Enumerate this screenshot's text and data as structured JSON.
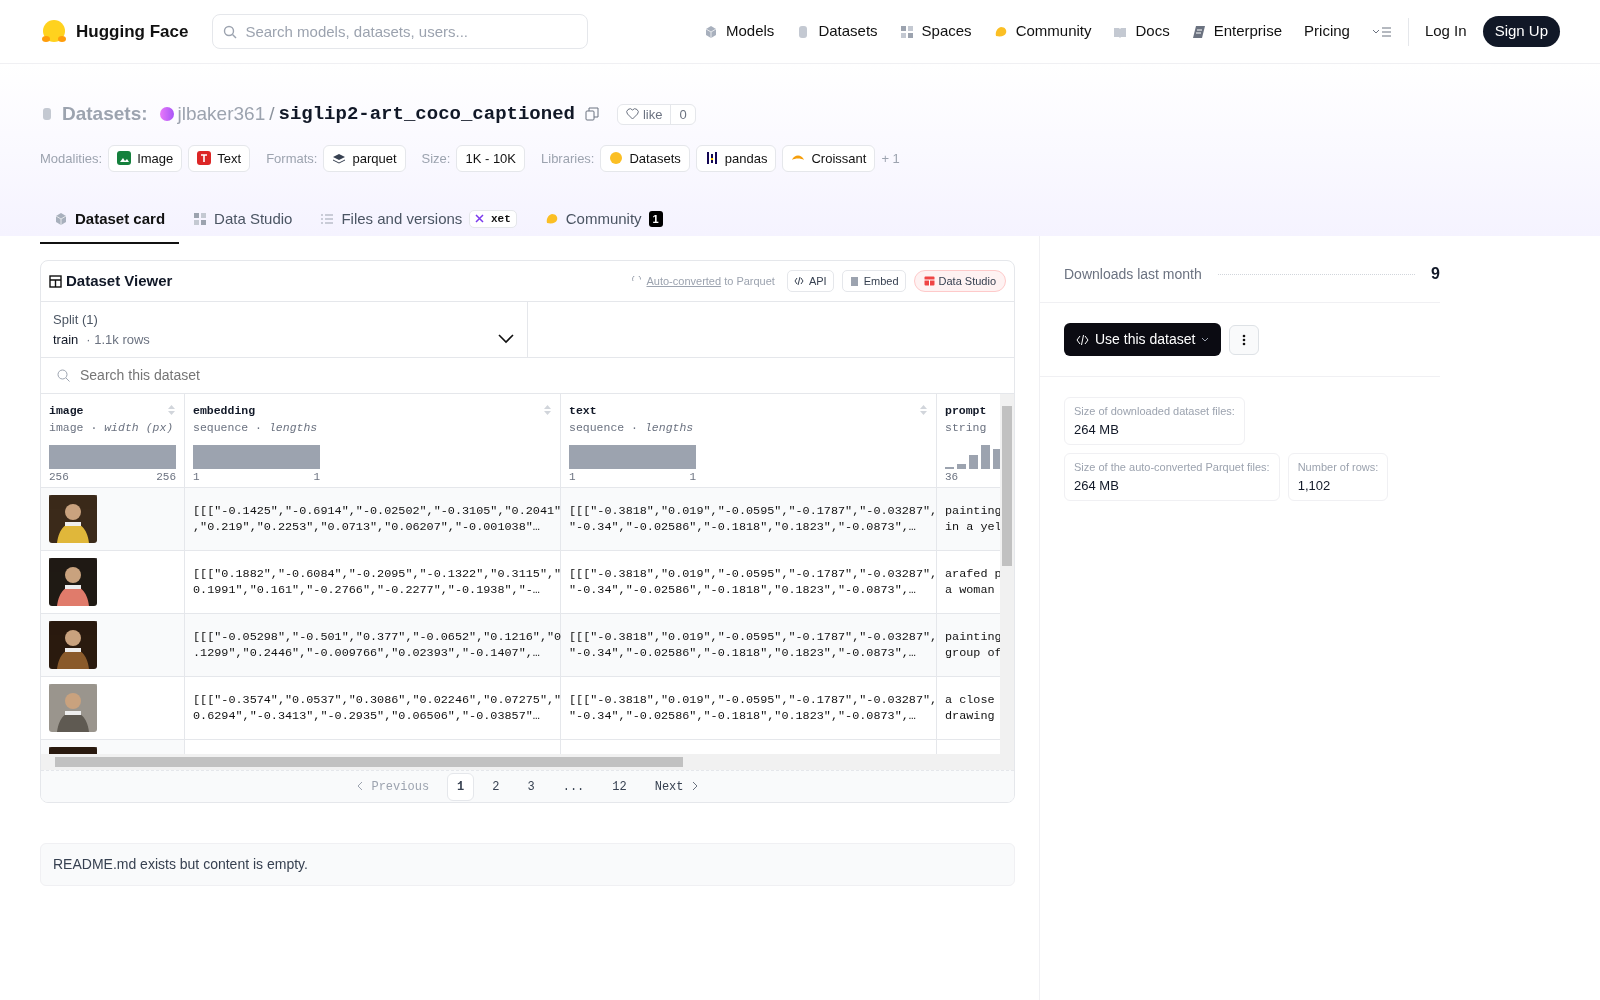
{
  "navbar": {
    "brand": "Hugging Face",
    "search_placeholder": "Search models, datasets, users...",
    "links": [
      {
        "label": "Models"
      },
      {
        "label": "Datasets"
      },
      {
        "label": "Spaces"
      },
      {
        "label": "Community"
      },
      {
        "label": "Docs"
      },
      {
        "label": "Enterprise"
      },
      {
        "label": "Pricing"
      }
    ],
    "login": "Log In",
    "signup": "Sign Up"
  },
  "dataset": {
    "type_label": "Datasets:",
    "owner": "jlbaker361",
    "separator": "/",
    "name": "siglip2-art_coco_captioned",
    "like": "like",
    "like_count": "0"
  },
  "tag_groups": [
    {
      "label": "Modalities:",
      "items": [
        "Image",
        "Text"
      ]
    },
    {
      "label": "Formats:",
      "items": [
        "parquet"
      ]
    },
    {
      "label": "Size:",
      "items": [
        "1K - 10K"
      ]
    },
    {
      "label": "Libraries:",
      "items": [
        "Datasets",
        "pandas",
        "Croissant"
      ],
      "more": "+ 1"
    }
  ],
  "tabs": [
    {
      "label": "Dataset card",
      "selected": true
    },
    {
      "label": "Data Studio",
      "selected": false
    },
    {
      "label": "Files and versions",
      "selected": false,
      "badge": "xet"
    },
    {
      "label": "Community",
      "selected": false,
      "count": "1"
    }
  ],
  "viewer": {
    "title": "Dataset Viewer",
    "auto_converted": "Auto-converted",
    "to_parquet": "to Parquet",
    "buttons": [
      "API",
      "Embed",
      "Data Studio"
    ],
    "split_label": "Split (1)",
    "split_value": "train",
    "split_rows": "· 1.1k rows",
    "search_placeholder": "Search this dataset",
    "columns": [
      {
        "name": "image",
        "subtitle": "image · *width (px)*",
        "min": "256",
        "max": "256"
      },
      {
        "name": "embedding",
        "subtitle": "sequence · *lengths*",
        "min": "1",
        "max": "1"
      },
      {
        "name": "text",
        "subtitle": "sequence · *lengths*",
        "min": "1",
        "max": "1"
      },
      {
        "name": "prompt",
        "subtitle": "string",
        "min": "36"
      }
    ],
    "rows": [
      {
        "image": {
          "kind": "picture"
        },
        "embedding": "[[[\"-0.1425\",\"-0.6914\",\"-0.02502\",\"-0.3105\",\"0.2041\"\n,\"0.219\",\"0.2253\",\"0.0713\",\"0.06207\",\"-0.001038\"…",
        "text": "[[[\"-0.3818\",\"0.019\",\"-0.0595\",\"-0.1787\",\"-0.03287\",\n\"-0.34\",\"-0.02586\",\"-0.1818\",\"0.1823\",\"-0.0873\",…",
        "prompt": "painting\nin a yel"
      },
      {
        "image": {
          "kind": "picture"
        },
        "embedding": "[[[\"0.1882\",\"-0.6084\",\"-0.2095\",\"-0.1322\",\"0.3115\",\"\n0.1991\",\"0.161\",\"-0.2766\",\"-0.2277\",\"-0.1938\",\"-…",
        "text": "[[[\"-0.3818\",\"0.019\",\"-0.0595\",\"-0.1787\",\"-0.03287\",\n\"-0.34\",\"-0.02586\",\"-0.1818\",\"0.1823\",\"-0.0873\",…",
        "prompt": "arafed p\na woman"
      },
      {
        "image": {
          "kind": "picture"
        },
        "embedding": "[[[\"-0.05298\",\"-0.501\",\"0.377\",\"-0.0652\",\"0.1216\",\"0\n.1299\",\"0.2446\",\"-0.009766\",\"0.02393\",\"-0.1407\",…",
        "text": "[[[\"-0.3818\",\"0.019\",\"-0.0595\",\"-0.1787\",\"-0.03287\",\n\"-0.34\",\"-0.02586\",\"-0.1818\",\"0.1823\",\"-0.0873\",…",
        "prompt": "painting\ngroup of"
      },
      {
        "image": {
          "kind": "picture"
        },
        "embedding": "[[[\"-0.3574\",\"0.0537\",\"0.3086\",\"0.02246\",\"0.07275\",\"\n0.6294\",\"-0.3413\",\"-0.2935\",\"0.06506\",\"-0.03857\"…",
        "text": "[[[\"-0.3818\",\"0.019\",\"-0.0595\",\"-0.1787\",\"-0.03287\",\n\"-0.34\",\"-0.02586\",\"-0.1818\",\"0.1823\",\"-0.0873\",…",
        "prompt": "a close\ndrawing"
      },
      {
        "image": {
          "kind": "picture"
        }
      }
    ],
    "pagination": {
      "previous": "Previous",
      "pages": [
        {
          "label": "1",
          "selected": true
        },
        {
          "label": "2",
          "selected": false
        },
        {
          "label": "3",
          "selected": false
        },
        {
          "label": "...",
          "selected": false
        },
        {
          "label": "12",
          "selected": false
        }
      ],
      "next": "Next"
    }
  },
  "readme": "README.md exists but content is empty.",
  "sidebar": {
    "downloads_label": "Downloads last month",
    "downloads": "9",
    "use_button": "Use this dataset",
    "stats": [
      {
        "label": "Size of downloaded dataset files:",
        "value": "264 MB"
      },
      {
        "label": "Size of the auto-converted Parquet files:",
        "value": "264 MB"
      },
      {
        "label": "Number of rows:",
        "value": "1,102"
      }
    ]
  }
}
